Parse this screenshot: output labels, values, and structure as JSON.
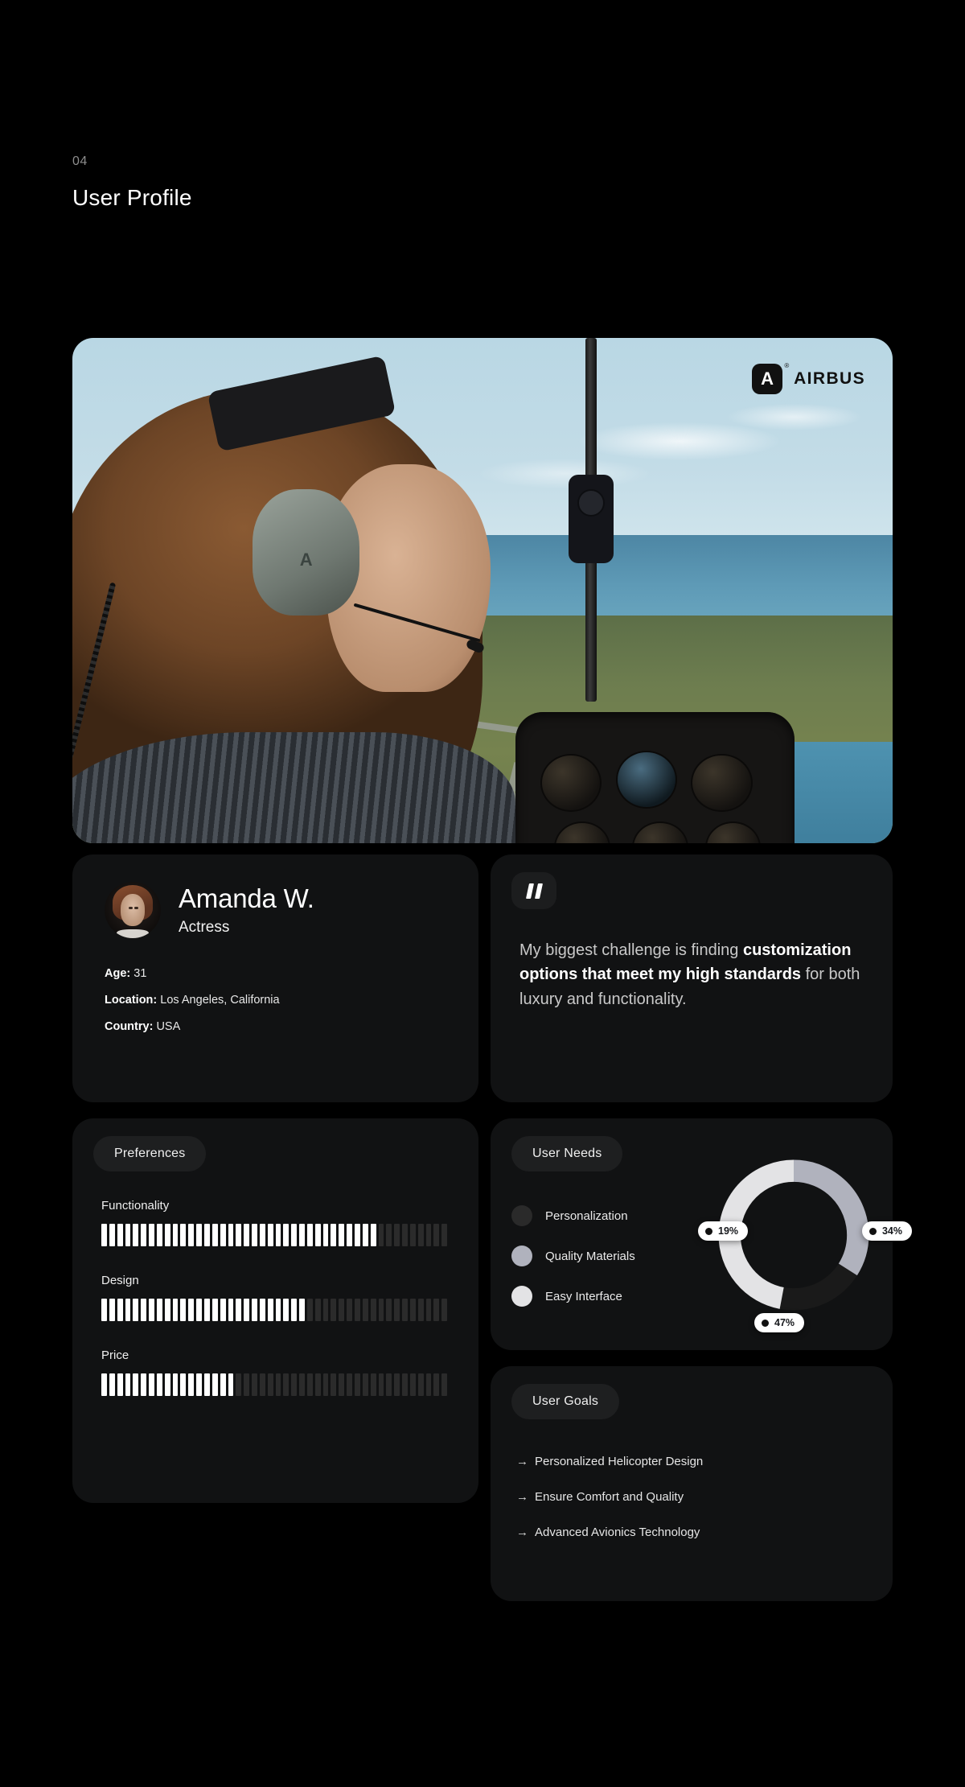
{
  "header": {
    "number": "04",
    "title": "User Profile"
  },
  "hero": {
    "brand": {
      "mark_letter": "A",
      "wordmark": "AIRBUS",
      "registered": "®"
    },
    "alt": "female-pilot-in-helicopter-cockpit-over-runway"
  },
  "profile": {
    "name": "Amanda W.",
    "role": "Actress",
    "meta": [
      {
        "label": "Age:",
        "value": "31"
      },
      {
        "label": "Location:",
        "value": "Los Angeles, California"
      },
      {
        "label": "Country:",
        "value": "USA"
      }
    ]
  },
  "quote": {
    "icon": "quote-mark-icon",
    "lead": "My biggest challenge is finding ",
    "emphasis": "customization options that meet my high standards",
    "tail": " for both luxury and functionality."
  },
  "preferences": {
    "chip_label": "Preferences",
    "items": [
      {
        "label": "Functionality",
        "value": 80
      },
      {
        "label": "Design",
        "value": 58
      },
      {
        "label": "Price",
        "value": 39
      }
    ],
    "tick_count": 44
  },
  "user_needs": {
    "chip_label": "User Needs",
    "legend": [
      {
        "label": "Personalization",
        "color": "#2a2a2a",
        "value": 19
      },
      {
        "label": "Quality Materials",
        "color": "#b0b2bd",
        "value": 34
      },
      {
        "label": "Easy Interface",
        "color": "#e3e3e5",
        "value": 47
      }
    ],
    "labels": [
      {
        "text": "19%",
        "position": "left"
      },
      {
        "text": "34%",
        "position": "right"
      },
      {
        "text": "47%",
        "position": "bottom"
      }
    ]
  },
  "user_goals": {
    "chip_label": "User Goals",
    "arrow": "→",
    "items": [
      "Personalized Helicopter Design",
      "Ensure Comfort and Quality",
      "Advanced Avionics Technology"
    ]
  },
  "chart_data": {
    "type": "pie",
    "title": "User Needs",
    "categories": [
      "Personalization",
      "Quality Materials",
      "Easy Interface"
    ],
    "values": [
      19,
      34,
      47
    ],
    "colors": [
      "#2a2a2a",
      "#b0b2bd",
      "#e3e3e5"
    ],
    "legend_position": "left",
    "donut": true,
    "units": "percent"
  },
  "colors": {
    "background": "#000000",
    "card": "#111213",
    "chip": "#1e1f20",
    "accent_white": "#ffffff",
    "meter_off": "#2b2b2b",
    "muted_text": "#8d8d8d"
  }
}
